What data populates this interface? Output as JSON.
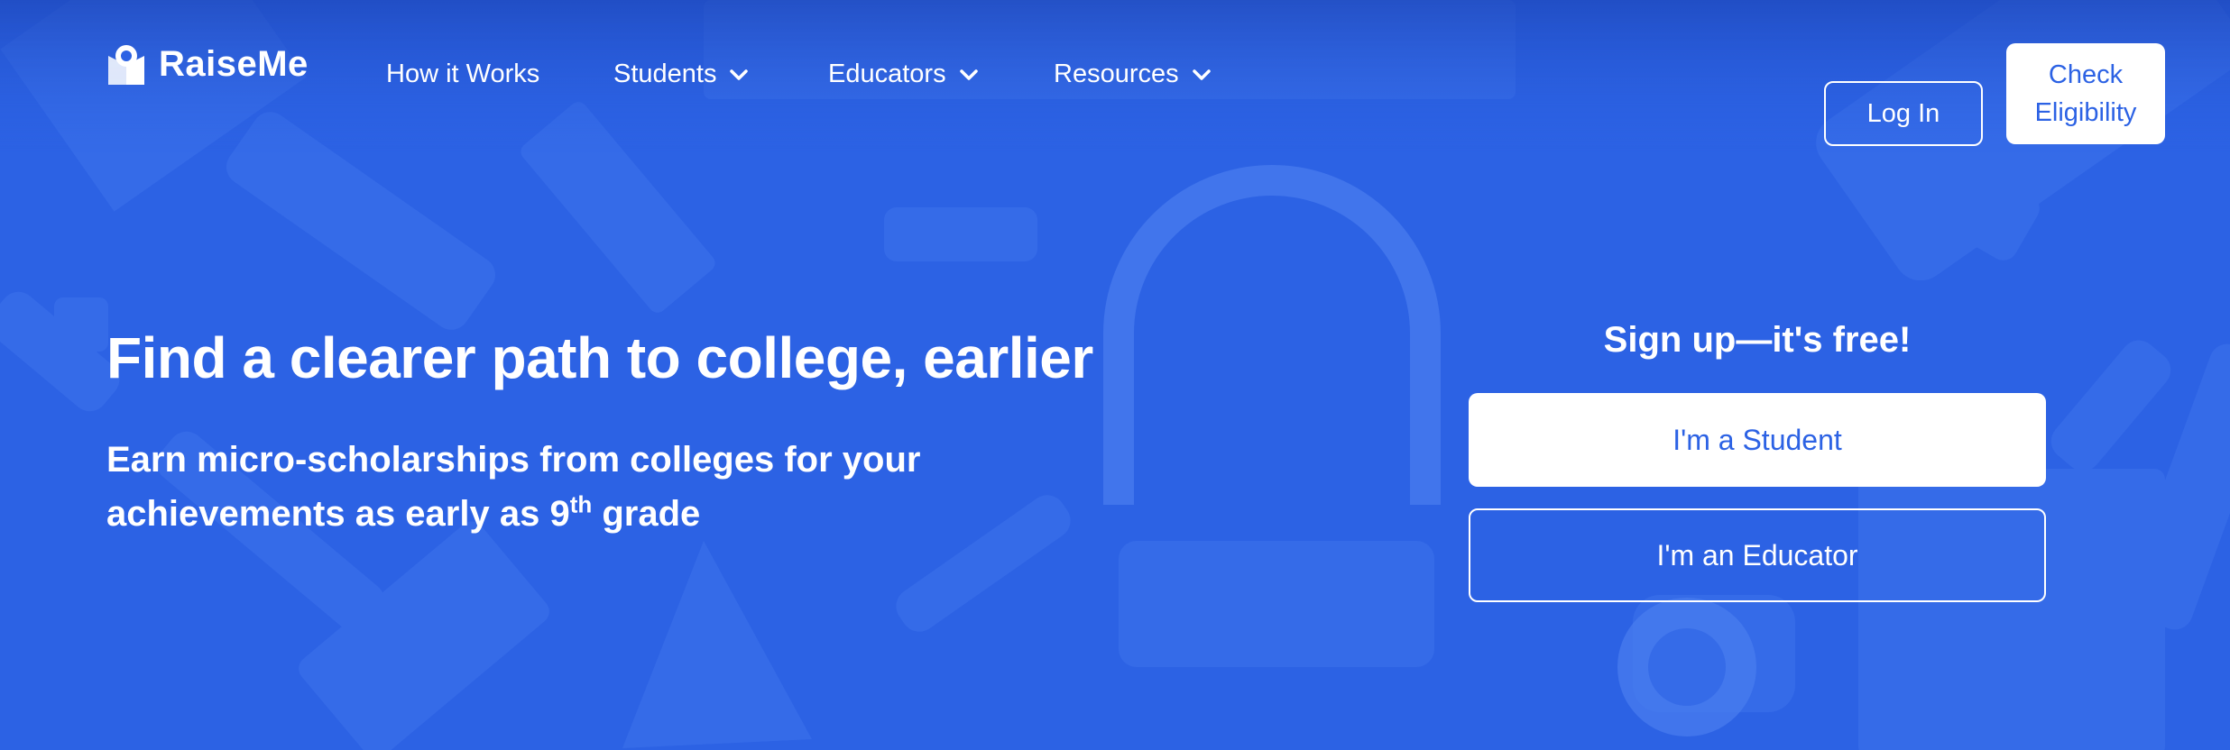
{
  "brand": {
    "name": "RaiseMe"
  },
  "nav": {
    "items": [
      {
        "label": "How it Works",
        "has_dropdown": false
      },
      {
        "label": "Students",
        "has_dropdown": true
      },
      {
        "label": "Educators",
        "has_dropdown": true
      },
      {
        "label": "Resources",
        "has_dropdown": true
      }
    ],
    "login_label": "Log In",
    "check_label_line1": "Check",
    "check_label_line2": "Eligibility"
  },
  "hero": {
    "title": "Find a clearer path to college, earlier",
    "subtitle_line1": "Earn micro-scholarships from colleges for your",
    "subtitle_line2_pre": "achievements as early as 9",
    "subtitle_sup": "th",
    "subtitle_line2_post": " grade"
  },
  "signup": {
    "title": "Sign up—it's free!",
    "student_label": "I'm a Student",
    "educator_label": "I'm an Educator"
  },
  "colors": {
    "background": "#2c62e4",
    "shape": "#4a7df0",
    "white": "#ffffff"
  },
  "icons": [
    "raiseme-logo-icon",
    "chevron-down-icon"
  ]
}
